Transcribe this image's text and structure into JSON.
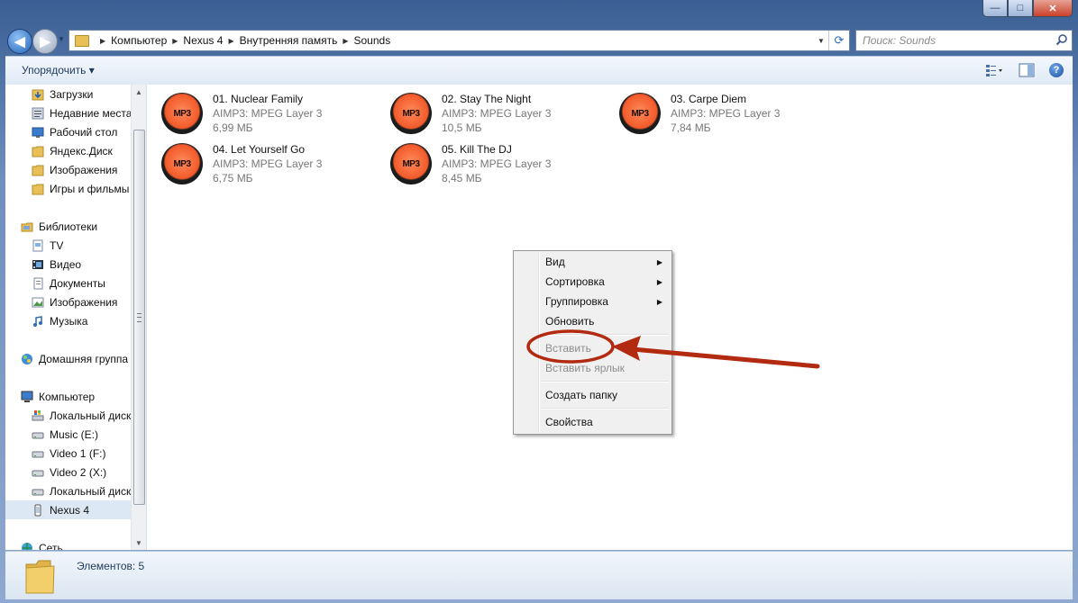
{
  "window": {
    "minimize_glyph": "—",
    "maximize_glyph": "□",
    "close_glyph": "✕"
  },
  "nav": {
    "back_glyph": "◀",
    "forward_glyph": "▶",
    "breadcrumb": [
      "Компьютер",
      "Nexus 4",
      "Внутренняя память",
      "Sounds"
    ],
    "search_placeholder": "Поиск: Sounds"
  },
  "toolbar": {
    "organize_label": "Упорядочить ▾"
  },
  "sidebar": {
    "favorites": [
      {
        "label": "Загрузки",
        "icon": "downloads-folder-icon"
      },
      {
        "label": "Недавние места",
        "icon": "recent-places-icon"
      },
      {
        "label": "Рабочий стол",
        "icon": "desktop-icon"
      },
      {
        "label": "Яндекс.Диск",
        "icon": "folder-icon"
      },
      {
        "label": "Изображения",
        "icon": "folder-icon"
      },
      {
        "label": "Игры и фильмы",
        "icon": "folder-icon"
      }
    ],
    "libraries_header": "Библиотеки",
    "libraries": [
      {
        "label": "TV",
        "icon": "tv-library-icon"
      },
      {
        "label": "Видео",
        "icon": "video-library-icon"
      },
      {
        "label": "Документы",
        "icon": "documents-library-icon"
      },
      {
        "label": "Изображения",
        "icon": "pictures-library-icon"
      },
      {
        "label": "Музыка",
        "icon": "music-library-icon"
      }
    ],
    "homegroup": "Домашняя группа",
    "computer_header": "Компьютер",
    "drives": [
      {
        "label": "Локальный диск",
        "icon": "system-drive-icon"
      },
      {
        "label": "Music (E:)",
        "icon": "drive-icon"
      },
      {
        "label": "Video 1 (F:)",
        "icon": "drive-icon"
      },
      {
        "label": "Video 2 (X:)",
        "icon": "drive-icon"
      },
      {
        "label": "Локальный диск",
        "icon": "drive-icon"
      },
      {
        "label": "Nexus 4",
        "icon": "phone-icon"
      }
    ],
    "network": "Сеть",
    "selected": "Nexus 4"
  },
  "files": [
    {
      "name": "01. Nuclear Family",
      "type": "AIMP3: MPEG Layer 3",
      "size": "6,99 МБ",
      "icon_text": "MP3"
    },
    {
      "name": "02. Stay The Night",
      "type": "AIMP3: MPEG Layer 3",
      "size": "10,5 МБ",
      "icon_text": "MP3"
    },
    {
      "name": "03. Carpe Diem",
      "type": "AIMP3: MPEG Layer 3",
      "size": "7,84 МБ",
      "icon_text": "MP3"
    },
    {
      "name": "04. Let Yourself Go",
      "type": "AIMP3: MPEG Layer 3",
      "size": "6,75 МБ",
      "icon_text": "MP3"
    },
    {
      "name": "05. Kill The DJ",
      "type": "AIMP3: MPEG Layer 3",
      "size": "8,45 МБ",
      "icon_text": "MP3"
    }
  ],
  "context_menu": {
    "items": [
      {
        "label": "Вид",
        "submenu": true,
        "disabled": false
      },
      {
        "label": "Сортировка",
        "submenu": true,
        "disabled": false
      },
      {
        "label": "Группировка",
        "submenu": true,
        "disabled": false
      },
      {
        "label": "Обновить",
        "submenu": false,
        "disabled": false
      },
      {
        "label": "Вставить",
        "submenu": false,
        "disabled": true
      },
      {
        "label": "Вставить ярлык",
        "submenu": false,
        "disabled": true
      },
      {
        "label": "Создать папку",
        "submenu": false,
        "disabled": false
      },
      {
        "label": "Свойства",
        "submenu": false,
        "disabled": false
      }
    ],
    "submenu_glyph": "▶"
  },
  "status": {
    "text": "Элементов: 5"
  },
  "colors": {
    "annotation": "#b22a10",
    "selection": "#dde8f5",
    "accent": "#2563b8"
  }
}
